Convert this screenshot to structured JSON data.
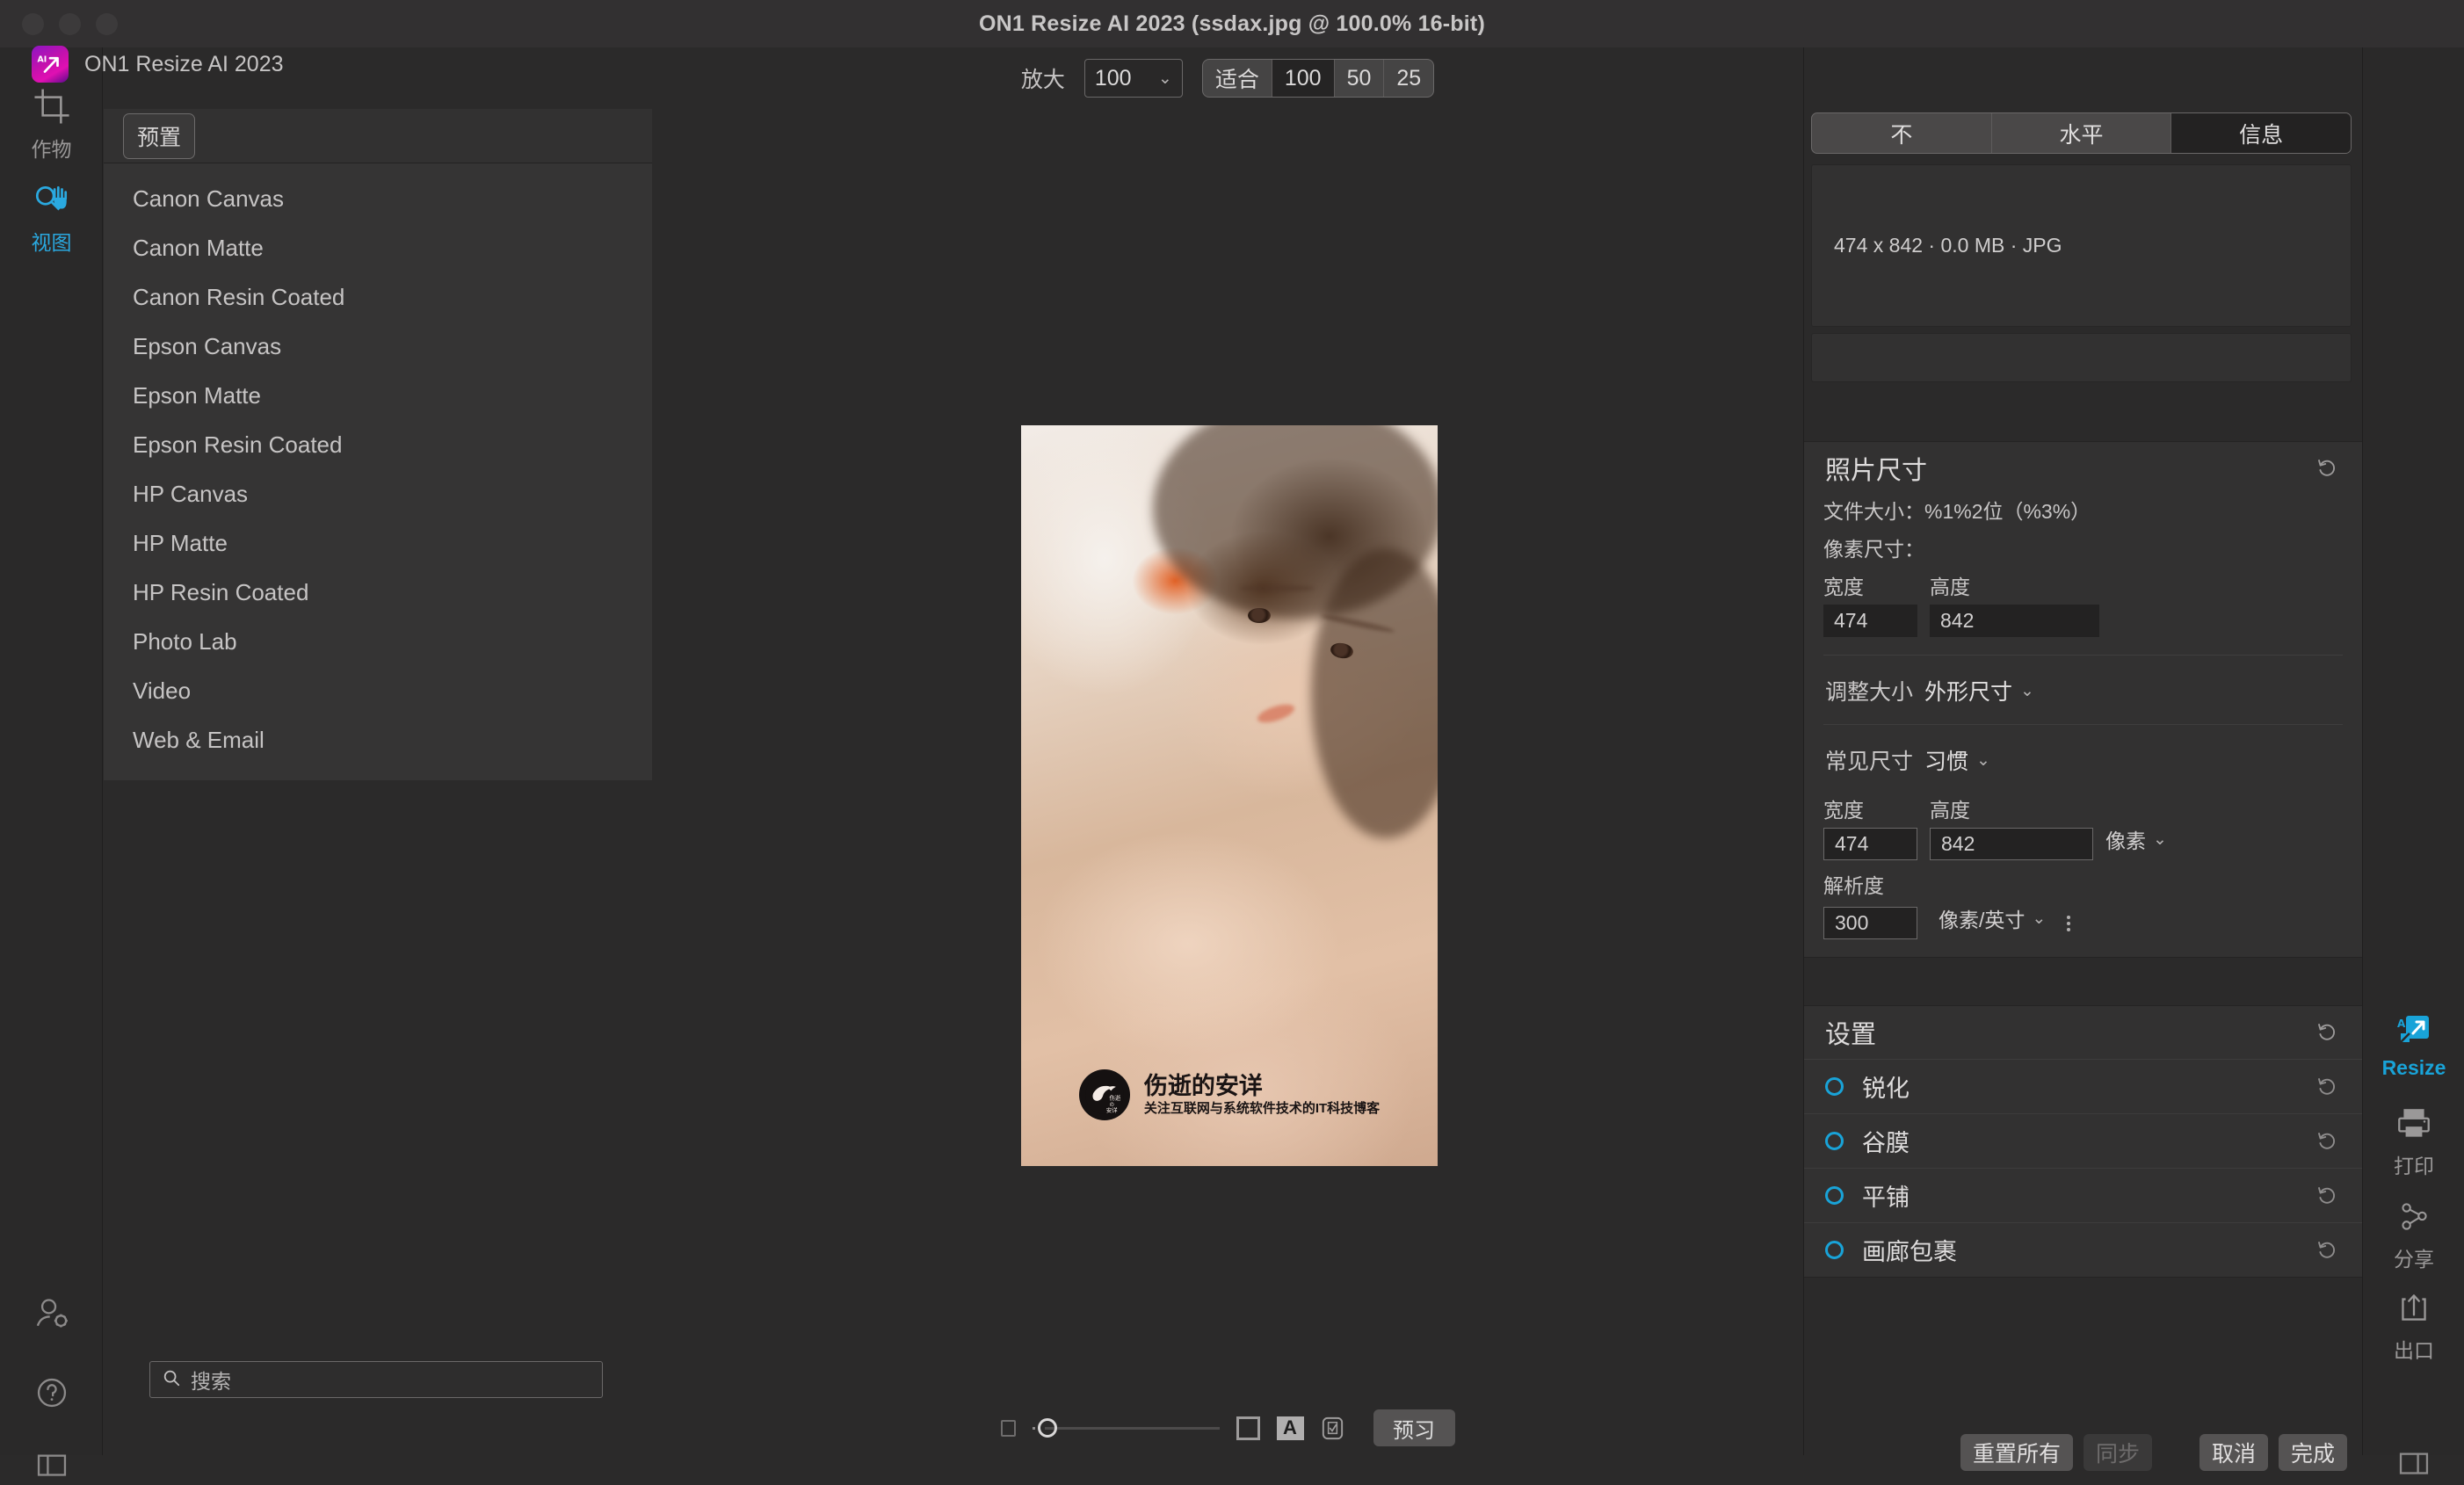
{
  "window": {
    "title": "ON1 Resize AI 2023 (ssdax.jpg @ 100.0% 16-bit)",
    "app_name": "ON1 Resize AI 2023"
  },
  "left_rail": {
    "items": [
      {
        "label": "作物",
        "icon": "crop-icon",
        "active": false
      },
      {
        "label": "视图",
        "icon": "pan-zoom-icon",
        "active": true
      }
    ],
    "bottom_icons": [
      {
        "icon": "user-settings-icon"
      },
      {
        "icon": "help-icon"
      },
      {
        "icon": "panel-toggle-icon"
      }
    ]
  },
  "presets": {
    "button_label": "预置",
    "items": [
      "Canon Canvas",
      "Canon Matte",
      "Canon Resin Coated",
      "Epson Canvas",
      "Epson Matte",
      "Epson Resin Coated",
      "HP Canvas",
      "HP Matte",
      "HP Resin Coated",
      "Photo Lab",
      "Video",
      "Web & Email"
    ]
  },
  "search": {
    "placeholder": "搜索",
    "value": "",
    "icon": "search-icon"
  },
  "toolbar": {
    "zoom_label": "放大",
    "zoom_value": "100",
    "fit_label": "适合",
    "zoom_presets": [
      "100",
      "50",
      "25"
    ],
    "active_zoom_preset": "100"
  },
  "canvas": {
    "watermark": {
      "title": "伤逝的安详",
      "subtitle": "关注互联网与系统软件技术的IT科技博客",
      "logo_line1": "伤逝",
      "logo_line2": "の",
      "logo_line3": "安详"
    }
  },
  "bottombar": {
    "preview_label": "预习",
    "icons": [
      "small-square-icon",
      "square-outline-icon",
      "text-overlay-icon",
      "checkmark-doc-icon"
    ]
  },
  "right_panel": {
    "tabs": [
      {
        "label": "不",
        "active": false
      },
      {
        "label": "水平",
        "active": false
      },
      {
        "label": "信息",
        "active": true
      }
    ],
    "info_text": "474 x 842 · 0.0 MB · JPG",
    "photo_size": {
      "title": "照片尺寸",
      "file_size_line": "文件大小：%1%2位（%3%）",
      "pixel_size_line": "像素尺寸：",
      "width_label": "宽度",
      "width_value": "474",
      "height_label": "高度",
      "height_value": "842",
      "resize_label": "调整大小",
      "resize_value": "外形尺寸",
      "common_label": "常见尺寸",
      "common_value": "习惯",
      "out_width_label": "宽度",
      "out_width_value": "474",
      "out_height_label": "高度",
      "out_height_value": "842",
      "unit_value": "像素",
      "resolution_label": "解析度",
      "resolution_value": "300",
      "resolution_unit": "像素/英寸"
    },
    "settings": {
      "title": "设置",
      "items": [
        {
          "label": "锐化"
        },
        {
          "label": "谷膜"
        },
        {
          "label": "平铺"
        },
        {
          "label": "画廊包裹"
        }
      ]
    }
  },
  "far_rail": {
    "items": [
      {
        "label": "Resize",
        "icon": "ai-resize-icon",
        "active": true
      },
      {
        "label": "打印",
        "icon": "printer-icon",
        "active": false
      },
      {
        "label": "分享",
        "icon": "share-icon",
        "active": false
      },
      {
        "label": "出口",
        "icon": "export-icon",
        "active": false
      }
    ],
    "bottom_icon": "panel-toggle-icon"
  },
  "footer_buttons": {
    "reset_all": "重置所有",
    "sync": "同步",
    "cancel": "取消",
    "done": "完成"
  },
  "colors": {
    "accent": "#19a3d8",
    "background": "#2b2a2a",
    "panel": "#323131"
  }
}
